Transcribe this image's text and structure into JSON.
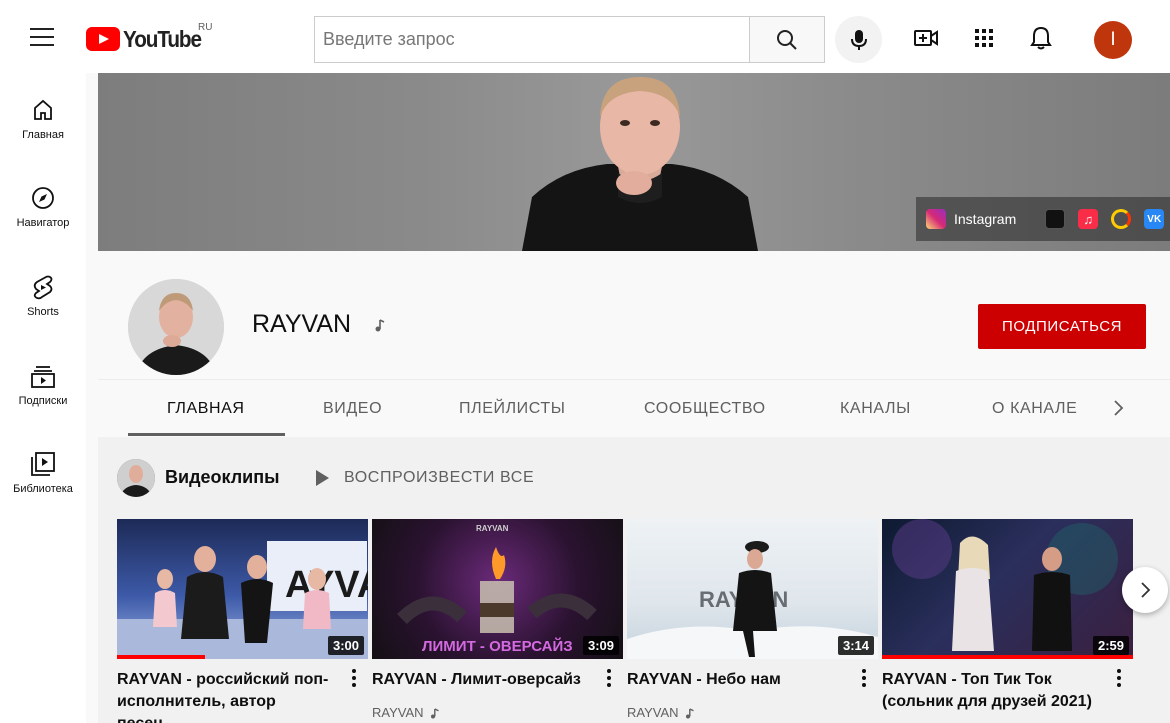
{
  "header": {
    "logo_text": "YouTube",
    "region": "RU",
    "search_placeholder": "Введите запрос",
    "avatar_letter": "I"
  },
  "sidebar": {
    "items": [
      {
        "label": "Главная",
        "icon": "home-icon"
      },
      {
        "label": "Навигатор",
        "icon": "compass-icon"
      },
      {
        "label": "Shorts",
        "icon": "shorts-icon"
      },
      {
        "label": "Подписки",
        "icon": "subscriptions-icon"
      },
      {
        "label": "Библиотека",
        "icon": "library-icon"
      }
    ]
  },
  "banner": {
    "links": [
      {
        "label": "Instagram",
        "icon": "instagram-icon",
        "color": "#c13584"
      },
      {
        "label": "",
        "icon": "tiktok-icon",
        "color": "#111111"
      },
      {
        "label": "",
        "icon": "apple-music-icon",
        "color": "#fa2d48"
      },
      {
        "label": "",
        "icon": "yandex-music-icon",
        "color": "#ffcc00"
      },
      {
        "label": "",
        "icon": "vk-icon",
        "color": "#2787f5"
      }
    ]
  },
  "channel": {
    "name": "RAYVAN",
    "subscribe_label": "ПОДПИСАТЬСЯ",
    "accent_color": "#cc0000"
  },
  "tabs": [
    {
      "label": "ГЛАВНАЯ",
      "active": true
    },
    {
      "label": "ВИДЕО",
      "active": false
    },
    {
      "label": "ПЛЕЙЛИСТЫ",
      "active": false
    },
    {
      "label": "СООБЩЕСТВО",
      "active": false
    },
    {
      "label": "КАНАЛЫ",
      "active": false
    },
    {
      "label": "О КАНАЛЕ",
      "active": false
    }
  ],
  "shelf": {
    "title": "Видеоклипы",
    "play_all_label": "ВОСПРОИЗВЕСТИ ВСЕ",
    "videos": [
      {
        "title": "RAYVAN - российский поп-исполнитель, автор песен,...",
        "channel": "",
        "duration": "3:00",
        "progress": 0.35
      },
      {
        "title": "RAYVAN - Лимит-оверсайз",
        "channel": "RAYVAN",
        "duration": "3:09",
        "progress": 0,
        "thumb_text": "ЛИМИТ - ОВЕРСАЙЗ",
        "thumb_brand": "RAYVAN"
      },
      {
        "title": "RAYVAN - Небо нам",
        "channel": "RAYVAN",
        "duration": "3:14",
        "progress": 0,
        "thumb_text": "RAYVAN"
      },
      {
        "title": "RAYVAN - Топ Тик Ток (сольник для друзей 2021)",
        "channel": "",
        "duration": "2:59",
        "progress": 1
      }
    ]
  }
}
